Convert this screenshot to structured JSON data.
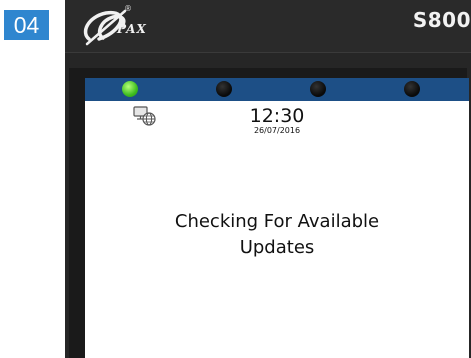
{
  "step": {
    "number": "04",
    "color": "#2f86cf"
  },
  "device": {
    "brand": "PAX",
    "reg_mark": "®",
    "model": "S800"
  },
  "status_bar": {
    "color": "#1d4f86",
    "leds": [
      {
        "state": "on",
        "color": "#3fbd1f"
      },
      {
        "state": "off"
      },
      {
        "state": "off"
      },
      {
        "state": "off"
      }
    ]
  },
  "screen": {
    "network_icon": "network-globe-icon",
    "time": "12:30",
    "date": "26/07/2016",
    "message_line1": "Checking For Available",
    "message_line2": "Updates"
  }
}
